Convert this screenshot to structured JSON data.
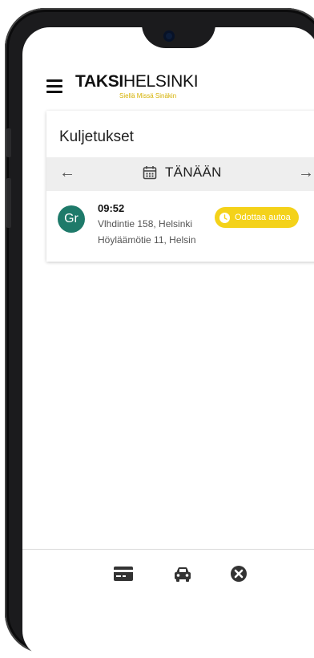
{
  "app": {
    "brand_bold": "TAKSI",
    "brand_regular": "HELSINKI",
    "tagline": "Siellä Missä Sinäkin"
  },
  "page": {
    "title": "Kuljetukset"
  },
  "date_nav": {
    "label": "TÄNÄÄN",
    "prev_icon": "←",
    "next_icon": "→"
  },
  "rides": [
    {
      "avatar": "Gr",
      "time": "09:52",
      "from": "Vlhdintie 158, Helsinki",
      "to": "Höyläämötie 11, Helsin",
      "status": "Odottaa autoa"
    }
  ],
  "bottom_nav": {
    "items": [
      "credit-card-icon",
      "taxi-icon",
      "close-circle-icon"
    ]
  },
  "colors": {
    "accent_yellow": "#f4d21a",
    "avatar_green": "#1e7a6a",
    "tagline_yellow": "#d4b000"
  }
}
